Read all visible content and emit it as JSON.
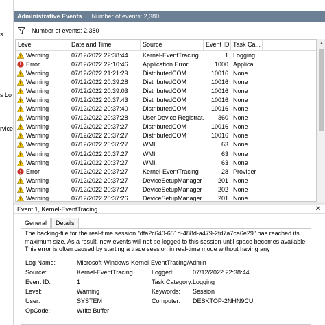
{
  "left_pane": {
    "fragments": [
      "s",
      "s Lo",
      "rvice"
    ]
  },
  "header": {
    "title": "Administrative Events",
    "count_text": "Number of events: 2,380"
  },
  "filter": {
    "icon": "filter-funnel-icon",
    "label": "Number of events: 2,380"
  },
  "table": {
    "columns": [
      "Level",
      "Date and Time",
      "Source",
      "Event ID",
      "Task Ca..."
    ],
    "rows": [
      {
        "level": "Warning",
        "date": "07/12/2022 22:38:44",
        "source": "Kernel-EventTracing",
        "id": "1",
        "task": "Logging"
      },
      {
        "level": "Error",
        "date": "07/12/2022 22:10:46",
        "source": "Application Error",
        "id": "1000",
        "task": "Applica..."
      },
      {
        "level": "Warning",
        "date": "07/12/2022 21:21:29",
        "source": "DistributedCOM",
        "id": "10016",
        "task": "None"
      },
      {
        "level": "Warning",
        "date": "07/12/2022 20:39:28",
        "source": "DistributedCOM",
        "id": "10016",
        "task": "None"
      },
      {
        "level": "Warning",
        "date": "07/12/2022 20:39:03",
        "source": "DistributedCOM",
        "id": "10016",
        "task": "None"
      },
      {
        "level": "Warning",
        "date": "07/12/2022 20:37:43",
        "source": "DistributedCOM",
        "id": "10016",
        "task": "None"
      },
      {
        "level": "Warning",
        "date": "07/12/2022 20:37:40",
        "source": "DistributedCOM",
        "id": "10016",
        "task": "None"
      },
      {
        "level": "Warning",
        "date": "07/12/2022 20:37:28",
        "source": "User Device Registrat...",
        "id": "360",
        "task": "None"
      },
      {
        "level": "Warning",
        "date": "07/12/2022 20:37:27",
        "source": "DistributedCOM",
        "id": "10016",
        "task": "None"
      },
      {
        "level": "Warning",
        "date": "07/12/2022 20:37:27",
        "source": "DistributedCOM",
        "id": "10016",
        "task": "None"
      },
      {
        "level": "Warning",
        "date": "07/12/2022 20:37:27",
        "source": "WMI",
        "id": "63",
        "task": "None"
      },
      {
        "level": "Warning",
        "date": "07/12/2022 20:37:27",
        "source": "WMI",
        "id": "63",
        "task": "None"
      },
      {
        "level": "Warning",
        "date": "07/12/2022 20:37:27",
        "source": "WMI",
        "id": "63",
        "task": "None"
      },
      {
        "level": "Error",
        "date": "07/12/2022 20:37:27",
        "source": "Kernel-EventTracing",
        "id": "28",
        "task": "Provider"
      },
      {
        "level": "Warning",
        "date": "07/12/2022 20:37:27",
        "source": "DeviceSetupManager",
        "id": "201",
        "task": "None"
      },
      {
        "level": "Warning",
        "date": "07/12/2022 20:37:27",
        "source": "DeviceSetupManager",
        "id": "202",
        "task": "None"
      },
      {
        "level": "Warning",
        "date": "07/12/2022 20:37:26",
        "source": "DeviceSetupManager",
        "id": "201",
        "task": "None"
      }
    ]
  },
  "details": {
    "title": "Event 1, Kernel-EventTracing",
    "close": "✕",
    "tabs": [
      "General",
      "Details"
    ],
    "description": "The backing-file for the real-time session \"dfa2c640-651d-488d-a479-2fd7a7ca6e29\" has reached its maximum size. As a result, new events will not be logged to this session until space becomes available. This error is often caused by starting a trace session in real-time mode without having any",
    "fields": {
      "log_name_label": "Log Name:",
      "log_name": "Microsoft-Windows-Kernel-EventTracing/Admin",
      "source_label": "Source:",
      "source": "Kernel-EventTracing",
      "logged_label": "Logged:",
      "logged": "07/12/2022 22:38:44",
      "event_id_label": "Event ID:",
      "event_id": "1",
      "task_label": "Task Category:",
      "task": "Logging",
      "level_label": "Level:",
      "level": "Warning",
      "keywords_label": "Keywords:",
      "keywords": "Session",
      "user_label": "User:",
      "user": "SYSTEM",
      "computer_label": "Computer:",
      "computer": "DESKTOP-2NHN9CU",
      "opcode_label": "OpCode:",
      "opcode": "Write Buffer"
    }
  },
  "colors": {
    "title_bar": "#6b7f95",
    "warning": "#f5c400",
    "error": "#c8312a"
  }
}
